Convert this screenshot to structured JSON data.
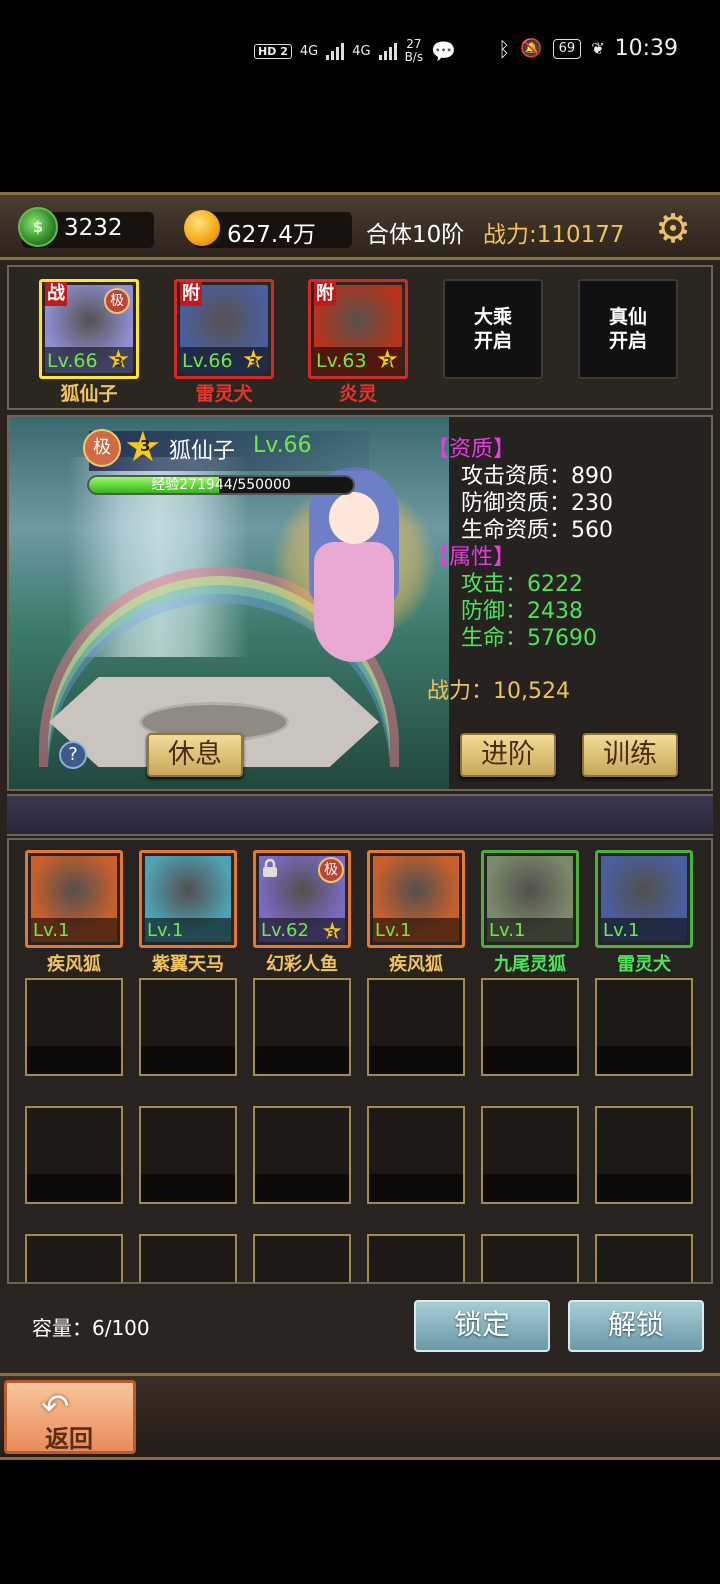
{
  "status_bar": {
    "hd": "HD",
    "sim": "2",
    "net1": "4G",
    "net2": "4G",
    "speed_value": "27",
    "speed_unit": "B/s",
    "battery": "69",
    "time": "10:39"
  },
  "resources": {
    "jade": "3232",
    "gold": "627.4万",
    "fusion": "合体10阶",
    "power": "战力:110177"
  },
  "party": [
    {
      "tag": "战",
      "rank": "极",
      "level": "Lv.66",
      "stars": "3",
      "name": "狐仙子",
      "name_color": "#f3c35b",
      "frame": "#ffe431",
      "bg": "#8f8fd6"
    },
    {
      "tag": "附",
      "rank": "",
      "level": "Lv.66",
      "stars": "3",
      "name": "雷灵犬",
      "name_color": "#e8342c",
      "frame": "#d32929",
      "bg": "#4a5fa0"
    },
    {
      "tag": "附",
      "rank": "",
      "level": "Lv.63",
      "stars": "3",
      "name": "炎灵",
      "name_color": "#e8342c",
      "frame": "#d32929",
      "bg": "#b8331a"
    }
  ],
  "locked_slots": [
    {
      "line1": "大乘",
      "line2": "开启"
    },
    {
      "line1": "真仙",
      "line2": "开启"
    }
  ],
  "hero": {
    "rank": "极",
    "stars": "3",
    "name": "狐仙子",
    "level": "Lv.66",
    "exp_text": "经验271944/550000",
    "exp_ratio": 0.494
  },
  "aptitude": {
    "title": "【资质】",
    "attack": "攻击资质：890",
    "defense": "防御资质：230",
    "hp": "生命资质：560"
  },
  "attributes": {
    "title": "【属性】",
    "attack": "攻击：6222",
    "defense": "防御：2438",
    "hp": "生命：57690"
  },
  "hero_power": "战力：10,524",
  "buttons": {
    "rest": "休息",
    "advance": "进阶",
    "train": "训练",
    "lock": "锁定",
    "unlock": "解锁",
    "help": "?",
    "back": "返回"
  },
  "bag": [
    {
      "level": "Lv.1",
      "name": "疾风狐",
      "name_color": "#f3c35b",
      "frame": "#e57a2a",
      "bg": "#c9602c"
    },
    {
      "level": "Lv.1",
      "name": "紫翼天马",
      "name_color": "#f3c35b",
      "frame": "#e57a2a",
      "bg": "#4fa1b3"
    },
    {
      "level": "Lv.62",
      "name": "幻彩人鱼",
      "name_color": "#f3c35b",
      "frame": "#e57a2a",
      "bg": "#7b6ac4",
      "stars": "3",
      "rank": "极",
      "locked": true
    },
    {
      "level": "Lv.1",
      "name": "疾风狐",
      "name_color": "#f3c35b",
      "frame": "#e57a2a",
      "bg": "#c9602c"
    },
    {
      "level": "Lv.1",
      "name": "九尾灵狐",
      "name_color": "#4fe35a",
      "frame": "#4caf3a",
      "bg": "#7a8a6a"
    },
    {
      "level": "Lv.1",
      "name": "雷灵犬",
      "name_color": "#4fe35a",
      "frame": "#4caf3a",
      "bg": "#4a5fa0"
    }
  ],
  "capacity": "容量：6/100"
}
